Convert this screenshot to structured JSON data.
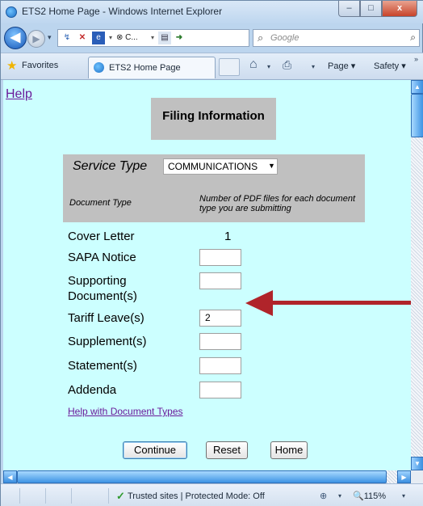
{
  "window": {
    "title": "ETS2 Home Page - Windows Internet Explorer",
    "minimize": "–",
    "maximize": "□",
    "close": "x"
  },
  "nav": {
    "back_glyph": "◀",
    "forward_glyph": "▶",
    "dropdown_glyph": "▾",
    "address_items": [
      "↯",
      "✕",
      "e",
      "▾",
      "⊗ C...",
      "▾",
      "▤",
      "➜"
    ],
    "search_placeholder": "Google",
    "search_glyph": "⌕"
  },
  "commandbar": {
    "favorites_label": "Favorites",
    "tab_label": "ETS2 Home Page",
    "page_menu": "Page ▾",
    "safety_menu": "Safety ▾",
    "more": "»",
    "dropdown_glyph": "▾"
  },
  "page": {
    "help_link": "Help",
    "heading": "Filing Information",
    "service_type_label": "Service Type",
    "service_type_value": "COMMUNICATIONS",
    "service_type_options": [
      "COMMUNICATIONS"
    ],
    "document_type_header": "Document Type",
    "count_header": "Number of PDF files for each document type you are submitting",
    "rows": [
      {
        "label": "Cover Letter",
        "value": "1"
      },
      {
        "label": "SAPA Notice",
        "value": ""
      },
      {
        "label": "Supporting Document(s)",
        "value": ""
      },
      {
        "label": "Tariff Leave(s)",
        "value": "2"
      },
      {
        "label": "Supplement(s)",
        "value": ""
      },
      {
        "label": "Statement(s)",
        "value": ""
      },
      {
        "label": "Addenda",
        "value": ""
      }
    ],
    "help_doc_types_link": "Help with Document Types",
    "continue_button": "Continue",
    "reset_button": "Reset",
    "home_button": "Home"
  },
  "statusbar": {
    "status_text": "Trusted sites | Protected Mode: Off",
    "zoom": "115%"
  },
  "colors": {
    "page_background": "#ccffff",
    "panel_gray": "#c0c0c0",
    "link_purple": "#6a1a9a",
    "annotation_arrow": "#b0242a"
  }
}
